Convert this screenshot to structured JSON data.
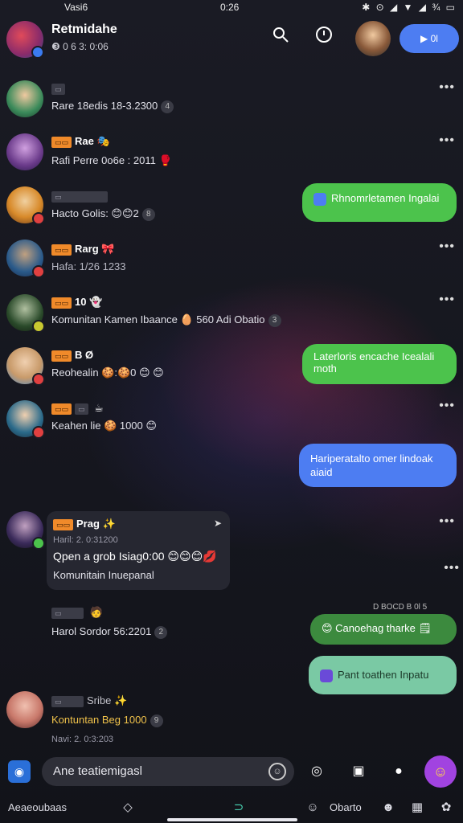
{
  "status": {
    "left_text": "Vasi6",
    "time": "0:26",
    "icons": "✱ ⊙ ◢ ▼ ◢ ¾ ▭"
  },
  "header": {
    "title": "Retmidahe",
    "subtitle": "❸ 0 6 3: 0:06",
    "call_label": "▶ 0l",
    "icons": {
      "search": "search-icon",
      "timer": "timer-icon",
      "call": "video-call-icon"
    }
  },
  "chats": [
    {
      "tags": [
        "▭"
      ],
      "name": "",
      "message": "Rare 18edis 18-3.2300",
      "badge": "4",
      "avatar_color": "#3a8a5a",
      "dot_color": ""
    },
    {
      "tags": [
        "▭▭"
      ],
      "name": "Rae",
      "message": "Rafi Perre 0o6e : 2011",
      "badge": "",
      "avatar_color": "#6a3a8a",
      "dot_color": ""
    },
    {
      "tags": [],
      "name": "",
      "message": "Hacto Golis: 😊😊2",
      "badge": "8",
      "avatar_color": "#d88a2a",
      "dot_color": "#e04040"
    },
    {
      "tags": [
        "▭▭"
      ],
      "name": "Rarg",
      "message": "Hafa: 1/26 1233",
      "badge": "",
      "avatar_color": "#2a5a8a",
      "dot_color": "#e04040"
    },
    {
      "tags": [
        "▭▭"
      ],
      "name": "10",
      "message": "Komunitan Kamen Ibaance 🥚 560 Adi Obatio",
      "badge": "3",
      "avatar_color": "#2a4a2a",
      "dot_color": "#c8c830"
    },
    {
      "tags": [
        "▭▭"
      ],
      "name": "B Ø",
      "message": "Reohealin 🍪:🍪0 😊 😊",
      "badge": "",
      "avatar_color": "#c89a6a",
      "dot_color": "#e04040"
    },
    {
      "tags": [
        "▭▭"
      ],
      "name": "",
      "message": "Keahen lie 🍪 1000 😊",
      "badge": "",
      "avatar_color": "#2a6a8a",
      "dot_color": "#e04040"
    },
    {
      "tags": [],
      "name": "",
      "message": "Harol Sordor 56:2201",
      "badge": "2",
      "avatar_color": "",
      "dot_color": ""
    },
    {
      "tags": [],
      "name": "Sribe",
      "message": "Kontuntan Beg 1000",
      "badge": "9",
      "avatar_color": "#c8786a",
      "dot_color": ""
    }
  ],
  "last_meta": "Navi: 2. 0:3:203",
  "bubbles": [
    {
      "text": "Rhnomrletamen Ingalai",
      "color": "green"
    },
    {
      "text": "Laterloris encache Icealali moth",
      "color": "green"
    },
    {
      "text": "Hariperatalto omer lindoak aiaid",
      "color": "blue"
    },
    {
      "text": "Canoehag tharke 🗒",
      "color": "darkgreen"
    },
    {
      "text": "Pant toathen Inpatu",
      "color": "teal"
    }
  ],
  "card": {
    "name": "Prag",
    "meta": "Haril: 2. 0:31200",
    "line1": "Qpen a grob Isiag0:00 😊😊😊💋",
    "line2": "Komunitain Inuepanal"
  },
  "side_note": "D BOCD B 0l 5",
  "input": {
    "placeholder": "Ane teatiemigasl"
  },
  "navbar": {
    "left": "Aeaeoubaas",
    "right": "Obarto"
  }
}
